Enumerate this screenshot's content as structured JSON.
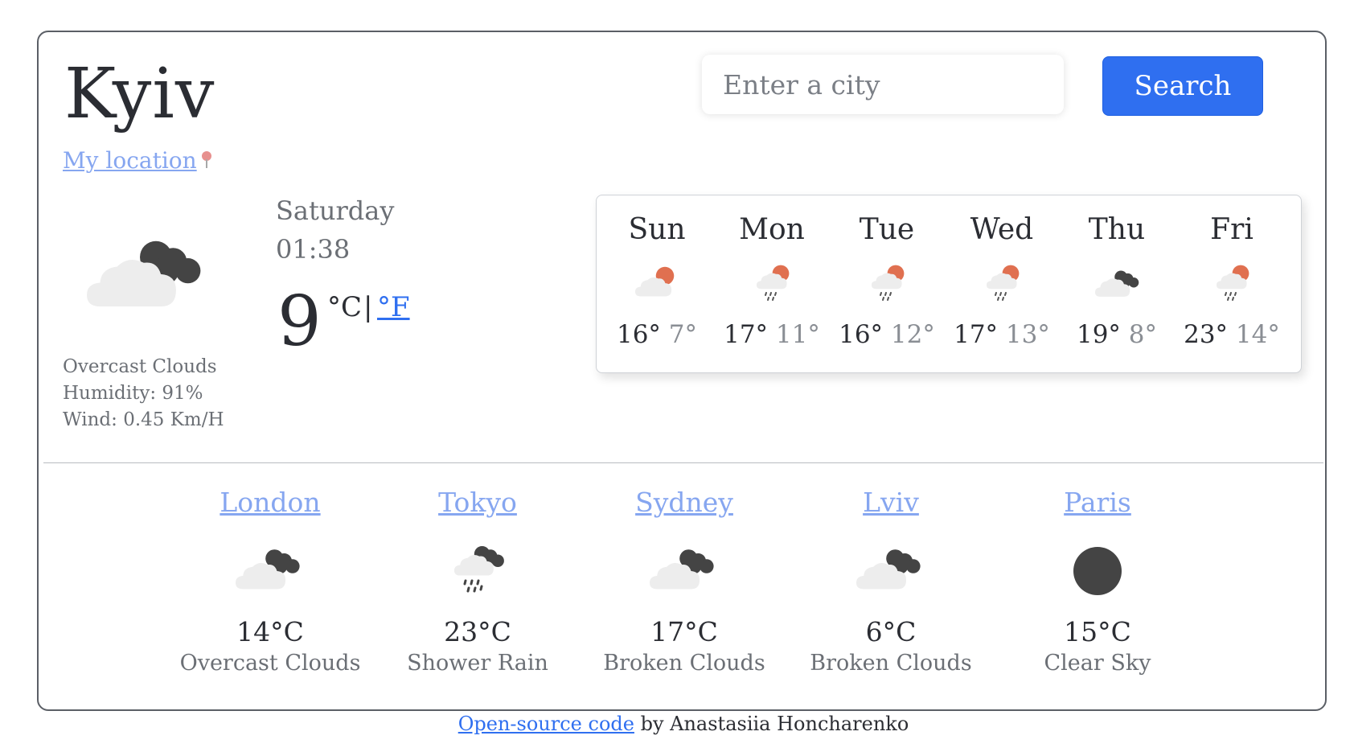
{
  "header": {
    "city": "Kyiv",
    "my_location_label": "My location"
  },
  "search": {
    "placeholder": "Enter a city",
    "button_label": "Search"
  },
  "current": {
    "icon": "overcast-clouds-icon",
    "description": "Overcast Clouds",
    "humidity_text": "Humidity: 91%",
    "wind_text": "Wind: 0.45 Km/H",
    "day": "Saturday",
    "time": "01:38",
    "temperature": "9",
    "unit_c": "°C",
    "unit_separator": "|",
    "unit_f": "°F"
  },
  "forecast": [
    {
      "day": "Sun",
      "icon": "sun-cloud-icon",
      "max": "16°",
      "min": "7°"
    },
    {
      "day": "Mon",
      "icon": "sun-rain-icon",
      "max": "17°",
      "min": "11°"
    },
    {
      "day": "Tue",
      "icon": "sun-rain-icon",
      "max": "16°",
      "min": "12°"
    },
    {
      "day": "Wed",
      "icon": "sun-rain-icon",
      "max": "17°",
      "min": "13°"
    },
    {
      "day": "Thu",
      "icon": "broken-clouds-icon",
      "max": "19°",
      "min": "8°"
    },
    {
      "day": "Fri",
      "icon": "sun-rain-icon",
      "max": "23°",
      "min": "14°"
    }
  ],
  "other_cities": [
    {
      "name": "London",
      "icon": "overcast-clouds-icon",
      "temp": "14°C",
      "description": "Overcast Clouds"
    },
    {
      "name": "Tokyo",
      "icon": "shower-rain-icon",
      "temp": "23°C",
      "description": "Shower Rain"
    },
    {
      "name": "Sydney",
      "icon": "broken-clouds-icon",
      "temp": "17°C",
      "description": "Broken Clouds"
    },
    {
      "name": "Lviv",
      "icon": "broken-clouds-icon",
      "temp": "6°C",
      "description": "Broken Clouds"
    },
    {
      "name": "Paris",
      "icon": "clear-sky-night-icon",
      "temp": "15°C",
      "description": "Clear Sky"
    }
  ],
  "footer": {
    "link_label": "Open-source code",
    "author_text": " by Anastasiia Honcharenko"
  },
  "colors": {
    "accent": "#2f6ff0",
    "link_light": "#86a6f0",
    "sun": "#e07050",
    "cloud": "#ededed",
    "dark_cloud": "#444444"
  }
}
